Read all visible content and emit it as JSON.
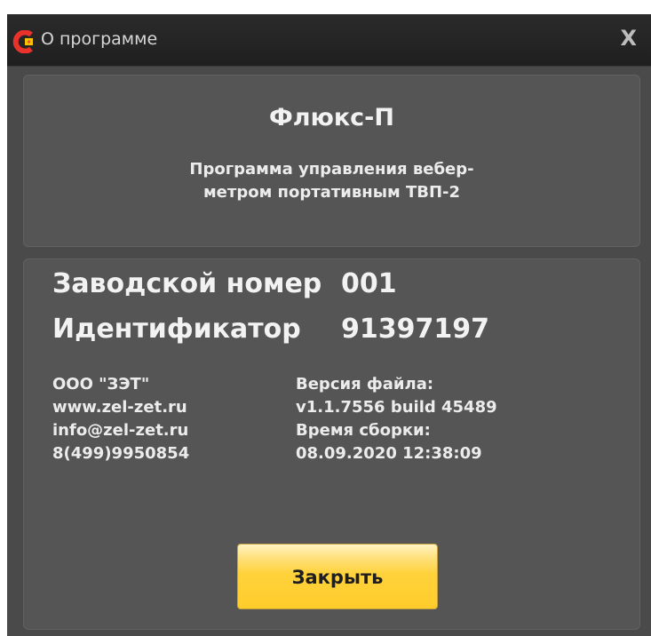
{
  "window": {
    "title": "О программе",
    "close_glyph": "X"
  },
  "product": {
    "name": "Флюкс-П",
    "description": "Программа управления вебер-\nметром портативным ТВП-2"
  },
  "device": {
    "serial_label": "Заводской номер",
    "serial_value": "001",
    "id_label": "Идентификатор",
    "id_value": "91397197"
  },
  "company": {
    "name": "ООО \"ЗЭТ\"",
    "website": "www.zel-zet.ru",
    "email": "info@zel-zet.ru",
    "phone": "8(499)9950854"
  },
  "build": {
    "version_label": "Версия файла:",
    "version_value": "v1.1.7556 build 45489",
    "time_label": "Время сборки:",
    "time_value": "08.09.2020 12:38:09"
  },
  "buttons": {
    "close_label": "Закрыть"
  },
  "colors": {
    "window_bg": "#4a4a4a",
    "titlebar_bg": "#252525",
    "panel_bg": "#555555",
    "button_accent": "#ffcc2a",
    "icon_red": "#e8322b",
    "icon_yellow": "#f5c300"
  },
  "icons": {
    "app": "app-logo-icon",
    "close": "close-icon"
  }
}
